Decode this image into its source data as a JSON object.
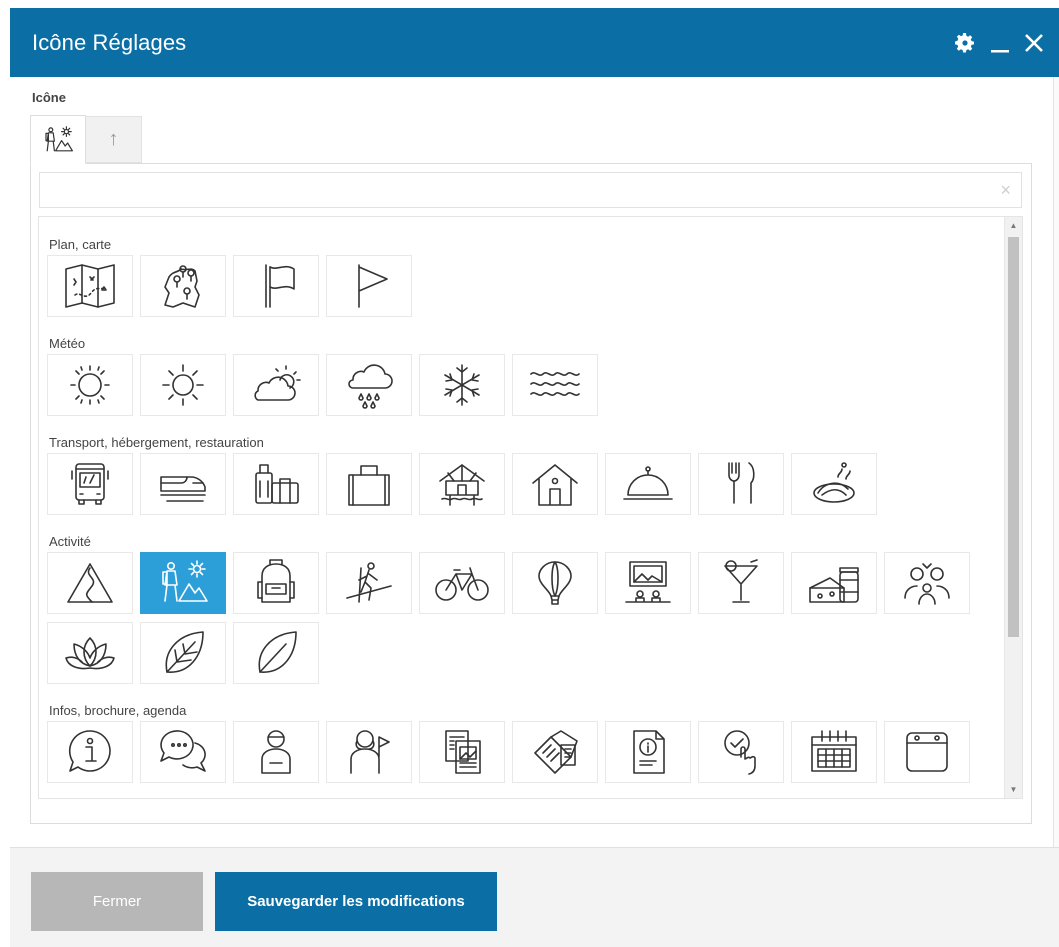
{
  "window": {
    "title": "Icône Réglages"
  },
  "section": {
    "label": "Icône"
  },
  "search": {
    "value": "",
    "placeholder": "",
    "clear_glyph": "×"
  },
  "tabs": {
    "up_glyph": "↑"
  },
  "categories": [
    {
      "label": "Plan, carte",
      "icons": [
        "folded-map-icon",
        "map-pins-icon",
        "flag-outline-icon",
        "pennant-flag-icon"
      ]
    },
    {
      "label": "Météo",
      "icons": [
        "sun-dotted-icon",
        "sun-icon",
        "partly-cloudy-icon",
        "rain-cloud-icon",
        "snowflake-icon",
        "waves-icon"
      ]
    },
    {
      "label": "Transport, hébergement, restauration",
      "icons": [
        "bus-icon",
        "train-icon",
        "luggage-icon",
        "bag-icon",
        "hut-icon",
        "house-icon",
        "cloche-icon",
        "fork-knife-icon",
        "plate-icon"
      ]
    },
    {
      "label": "Activité",
      "icons": [
        "mountain-path-icon",
        "hiker-sun-icon",
        "backpack-icon",
        "skier-icon",
        "bicycle-icon",
        "hot-air-balloon-icon",
        "museum-painting-icon",
        "cocktail-icon",
        "cheese-jar-icon",
        "family-icon",
        "lotus-icon",
        "leaf-veined-icon",
        "leaf-icon"
      ]
    },
    {
      "label": "Infos, brochure, agenda",
      "icons": [
        "info-bubble-icon",
        "chat-bubbles-icon",
        "guide-person-icon",
        "tour-guide-flag-icon",
        "brochure-image-icon",
        "newspapers-icon",
        "info-document-icon",
        "check-touch-icon",
        "calendar-grid-icon",
        "calendar-blank-icon"
      ]
    }
  ],
  "selected_icon": "hiker-sun-icon",
  "footer": {
    "close_label": "Fermer",
    "save_label": "Sauvegarder les modifications"
  },
  "colors": {
    "accent": "#0b6fa6",
    "selected": "#2c9fd8",
    "disabled": "#b7b7b7"
  }
}
